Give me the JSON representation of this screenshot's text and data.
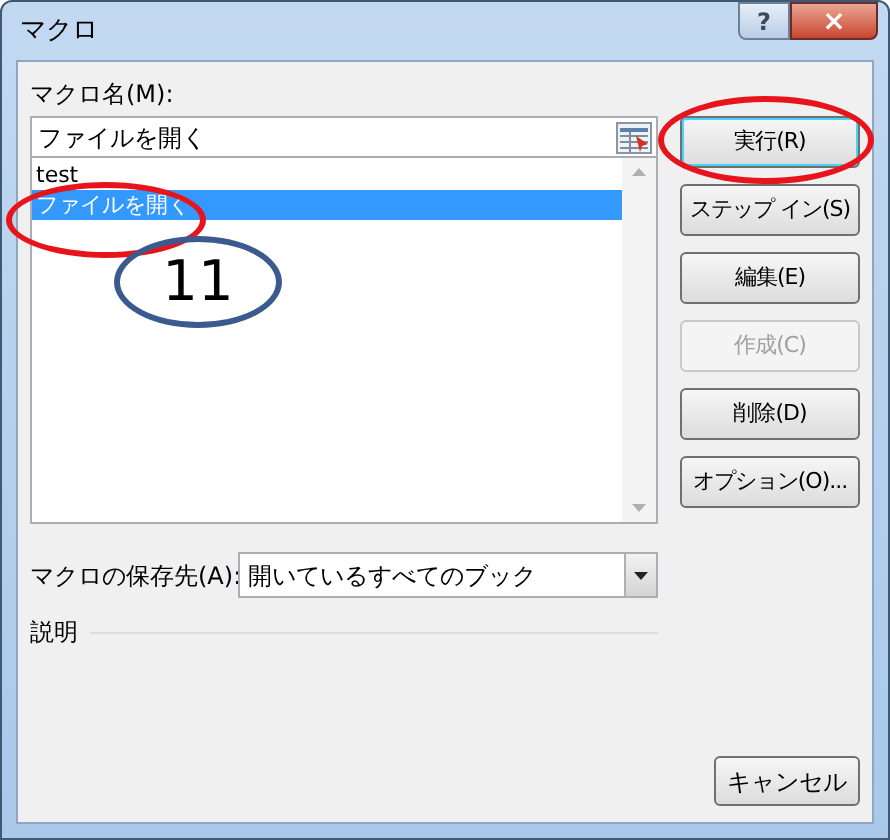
{
  "window": {
    "title": "マクロ",
    "help_button": "?",
    "close_button": "×"
  },
  "macro_name": {
    "label": "マクロ名(M):",
    "value": "ファイルを開く"
  },
  "macro_list": {
    "items": [
      {
        "name": "test",
        "selected": false
      },
      {
        "name": "ファイルを開く",
        "selected": true
      }
    ]
  },
  "buttons": [
    {
      "label": "実行(R)",
      "default": true,
      "disabled": false
    },
    {
      "label": "ステップ イン(S)",
      "default": false,
      "disabled": false
    },
    {
      "label": "編集(E)",
      "default": false,
      "disabled": false
    },
    {
      "label": "作成(C)",
      "default": false,
      "disabled": true
    },
    {
      "label": "削除(D)",
      "default": false,
      "disabled": false
    },
    {
      "label": "オプション(O)...",
      "default": false,
      "disabled": false
    }
  ],
  "storage": {
    "label": "マクロの保存先(A):",
    "value": "開いているすべてのブック"
  },
  "description": {
    "label": "説明"
  },
  "cancel_button": "キャンセル",
  "annotations": [
    {
      "kind": "ellipse",
      "color": "#e8141c"
    },
    {
      "kind": "ellipse",
      "color": "#e8141c"
    },
    {
      "kind": "ellipse",
      "color": "#3b5b8e",
      "text": "11"
    }
  ]
}
